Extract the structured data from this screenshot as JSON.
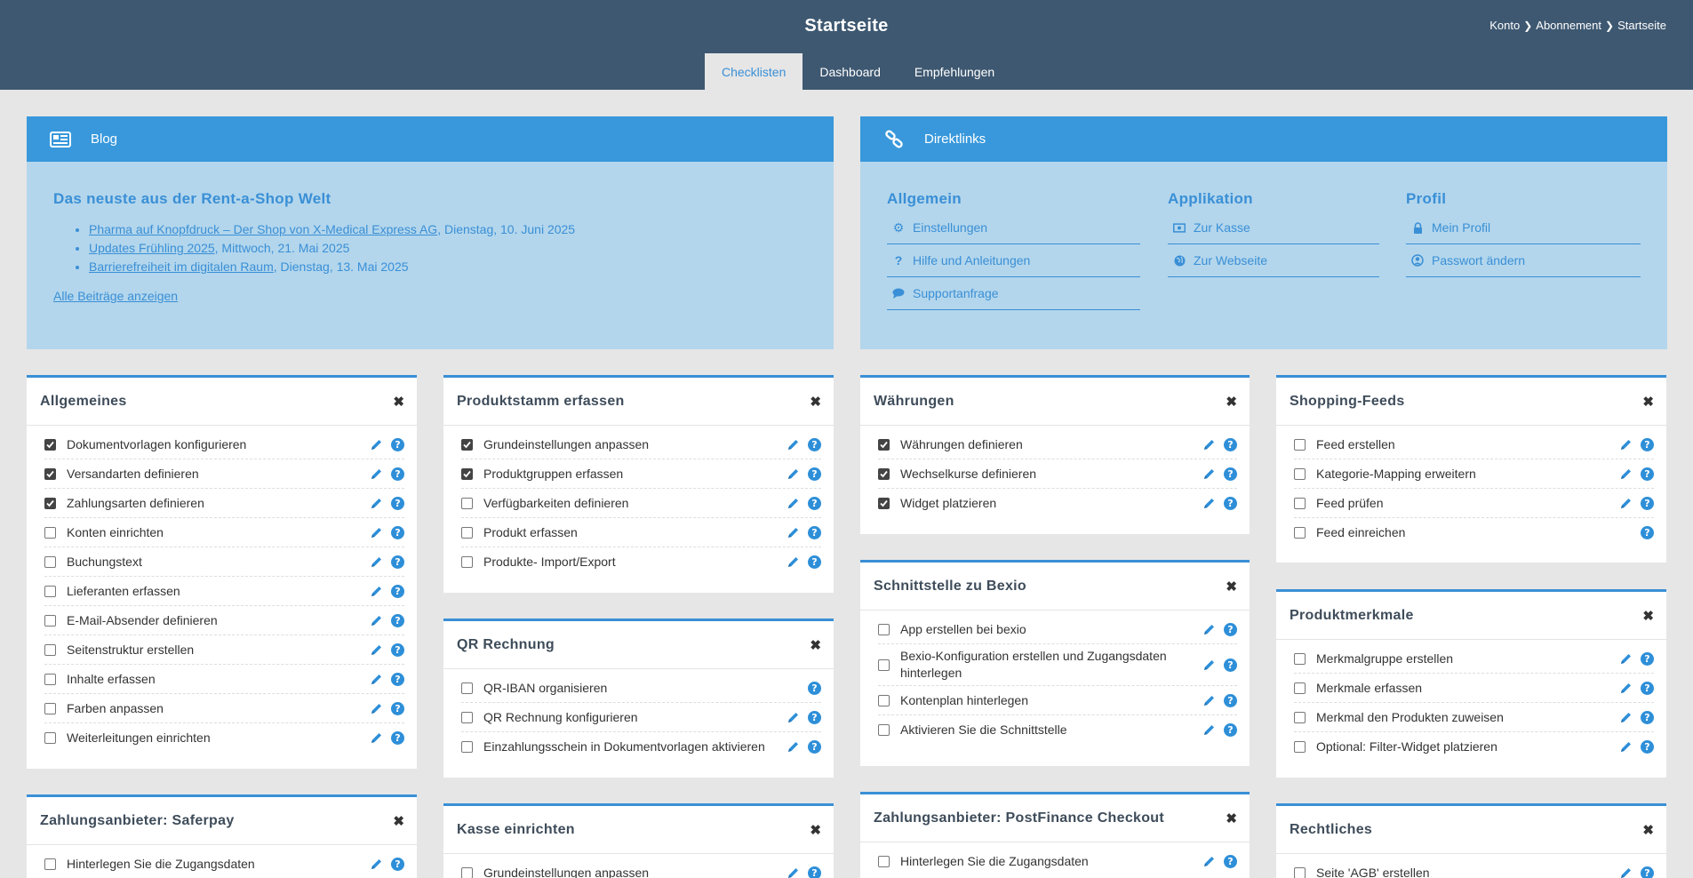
{
  "header": {
    "title": "Startseite",
    "breadcrumbs": [
      "Konto",
      "Abonnement",
      "Startseite"
    ],
    "tabs": [
      {
        "label": "Checklisten",
        "active": true
      },
      {
        "label": "Dashboard",
        "active": false
      },
      {
        "label": "Empfehlungen",
        "active": false
      }
    ]
  },
  "blog": {
    "panel_title": "Blog",
    "heading": "Das neuste aus der Rent-a-Shop Welt",
    "posts": [
      {
        "title": "Pharma auf Knopfdruck – Der Shop von X-Medical Express AG",
        "date": ", Dienstag, 10. Juni 2025"
      },
      {
        "title": "Updates Frühling 2025",
        "date": ", Mittwoch, 21. Mai 2025"
      },
      {
        "title": "Barrierefreiheit im digitalen Raum",
        "date": ", Dienstag, 13. Mai 2025"
      }
    ],
    "all_link": "Alle Beiträge anzeigen"
  },
  "direktlinks": {
    "panel_title": "Direktlinks",
    "columns": [
      {
        "heading": "Allgemein",
        "links": [
          {
            "label": "Einstellungen",
            "icon": "gear-icon"
          },
          {
            "label": "Hilfe und Anleitungen",
            "icon": "question-icon"
          },
          {
            "label": "Supportanfrage",
            "icon": "comment-icon"
          }
        ]
      },
      {
        "heading": "Applikation",
        "links": [
          {
            "label": "Zur Kasse",
            "icon": "cash-icon"
          },
          {
            "label": "Zur Webseite",
            "icon": "globe-icon"
          }
        ]
      },
      {
        "heading": "Profil",
        "links": [
          {
            "label": "Mein Profil",
            "icon": "lock-icon"
          },
          {
            "label": "Passwort ändern",
            "icon": "user-circle-icon"
          }
        ]
      }
    ]
  },
  "cards": {
    "allgemeines": {
      "title": "Allgemeines",
      "items": [
        {
          "label": "Dokumentvorlagen konfigurieren",
          "checked": true,
          "edit": true
        },
        {
          "label": "Versandarten definieren",
          "checked": true,
          "edit": true
        },
        {
          "label": "Zahlungsarten definieren",
          "checked": true,
          "edit": true
        },
        {
          "label": "Konten einrichten",
          "checked": false,
          "edit": true
        },
        {
          "label": "Buchungstext",
          "checked": false,
          "edit": true
        },
        {
          "label": "Lieferanten erfassen",
          "checked": false,
          "edit": true
        },
        {
          "label": "E-Mail-Absender definieren",
          "checked": false,
          "edit": true
        },
        {
          "label": "Seitenstruktur erstellen",
          "checked": false,
          "edit": true
        },
        {
          "label": "Inhalte erfassen",
          "checked": false,
          "edit": true
        },
        {
          "label": "Farben anpassen",
          "checked": false,
          "edit": true
        },
        {
          "label": "Weiterleitungen einrichten",
          "checked": false,
          "edit": true
        }
      ]
    },
    "saferpay": {
      "title": "Zahlungsanbieter: Saferpay",
      "items": [
        {
          "label": "Hinterlegen Sie die Zugangsdaten",
          "checked": false,
          "edit": true
        }
      ]
    },
    "produktstamm": {
      "title": "Produktstamm erfassen",
      "items": [
        {
          "label": "Grundeinstellungen anpassen",
          "checked": true,
          "edit": true
        },
        {
          "label": "Produktgruppen erfassen",
          "checked": true,
          "edit": true
        },
        {
          "label": "Verfügbarkeiten definieren",
          "checked": false,
          "edit": true
        },
        {
          "label": "Produkt erfassen",
          "checked": false,
          "edit": true
        },
        {
          "label": "Produkte- Import/Export",
          "checked": false,
          "edit": true
        }
      ]
    },
    "qr": {
      "title": "QR Rechnung",
      "items": [
        {
          "label": "QR-IBAN organisieren",
          "checked": false,
          "edit": false
        },
        {
          "label": "QR Rechnung konfigurieren",
          "checked": false,
          "edit": true
        },
        {
          "label": "Einzahlungsschein in Dokumentvorlagen aktivieren",
          "checked": false,
          "edit": true
        }
      ]
    },
    "kasse": {
      "title": "Kasse einrichten",
      "items": [
        {
          "label": "Grundeinstellungen anpassen",
          "checked": false,
          "edit": true
        }
      ]
    },
    "waehrungen": {
      "title": "Währungen",
      "items": [
        {
          "label": "Währungen definieren",
          "checked": true,
          "edit": true
        },
        {
          "label": "Wechselkurse definieren",
          "checked": true,
          "edit": true
        },
        {
          "label": "Widget platzieren",
          "checked": true,
          "edit": true
        }
      ]
    },
    "bexio": {
      "title": "Schnittstelle zu Bexio",
      "items": [
        {
          "label": "App erstellen bei bexio",
          "checked": false,
          "edit": true
        },
        {
          "label": "Bexio-Konfiguration erstellen und Zugangsdaten hinterlegen",
          "checked": false,
          "edit": true
        },
        {
          "label": "Kontenplan hinterlegen",
          "checked": false,
          "edit": true
        },
        {
          "label": "Aktivieren Sie die Schnittstelle",
          "checked": false,
          "edit": true
        }
      ]
    },
    "postfinance": {
      "title": "Zahlungsanbieter: PostFinance Checkout",
      "items": [
        {
          "label": "Hinterlegen Sie die Zugangsdaten",
          "checked": false,
          "edit": true
        }
      ]
    },
    "feeds": {
      "title": "Shopping-Feeds",
      "items": [
        {
          "label": "Feed erstellen",
          "checked": false,
          "edit": true
        },
        {
          "label": "Kategorie-Mapping erweitern",
          "checked": false,
          "edit": true
        },
        {
          "label": "Feed prüfen",
          "checked": false,
          "edit": true
        },
        {
          "label": "Feed einreichen",
          "checked": false,
          "edit": false
        }
      ]
    },
    "merkmale": {
      "title": "Produktmerkmale",
      "items": [
        {
          "label": "Merkmalgruppe erstellen",
          "checked": false,
          "edit": true
        },
        {
          "label": "Merkmale erfassen",
          "checked": false,
          "edit": true
        },
        {
          "label": "Merkmal den Produkten zuweisen",
          "checked": false,
          "edit": true
        },
        {
          "label": "Optional: Filter-Widget platzieren",
          "checked": false,
          "edit": true
        }
      ]
    },
    "rechtliches": {
      "title": "Rechtliches",
      "items": [
        {
          "label": "Seite 'AGB' erstellen",
          "checked": false,
          "edit": true
        }
      ]
    }
  },
  "colors": {
    "header": "#3e5871",
    "accent": "#3898db",
    "panel": "#b3d6ec",
    "link": "#3a8fd6"
  }
}
